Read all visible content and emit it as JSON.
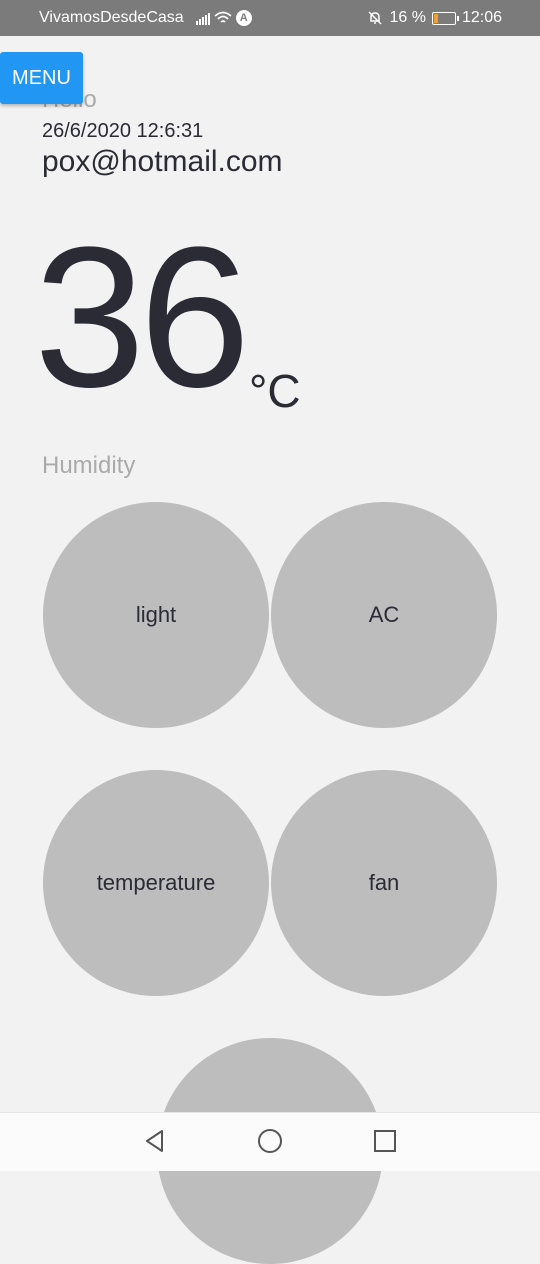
{
  "status_bar": {
    "carrier": "VivamosDesdeCasa",
    "nav_badge": "A",
    "battery": "16 %",
    "time": "12:06"
  },
  "menu": {
    "label": "MENU"
  },
  "header": {
    "greeting": "Hello",
    "datetime": "26/6/2020 12:6:31",
    "email": "pox@hotmail.com"
  },
  "temperature": {
    "value": "36",
    "unit": "°C"
  },
  "humidity": {
    "label": "Humidity"
  },
  "controls": [
    {
      "label": "light"
    },
    {
      "label": "AC"
    },
    {
      "label": "temperature"
    },
    {
      "label": "fan"
    },
    {
      "label": ""
    }
  ],
  "colors": {
    "menu_button": "#2196f3",
    "circle_button": "#bdbdbd",
    "background": "#f2f2f2",
    "text": "#2b2b35",
    "muted_text": "#aaaaaa",
    "status_bar": "#7b7b7b"
  },
  "icons": [
    "signal-icon",
    "wifi-icon",
    "mute-bell-icon",
    "battery-icon",
    "back-icon",
    "home-icon",
    "recents-icon"
  ]
}
